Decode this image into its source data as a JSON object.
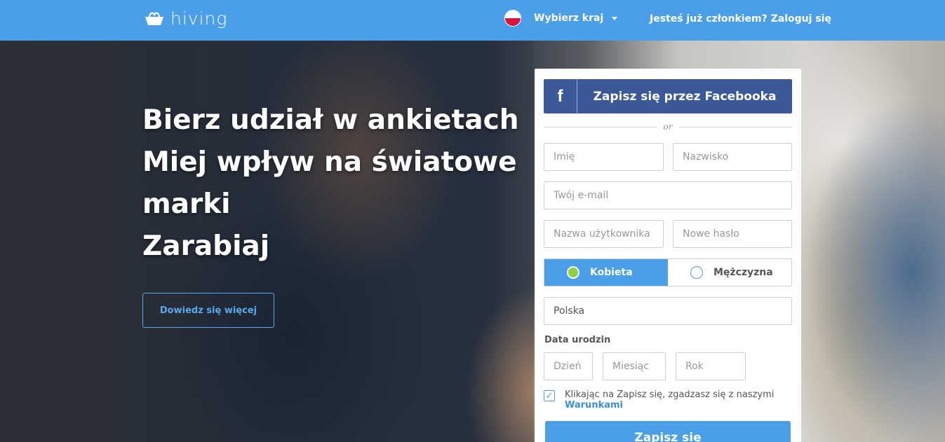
{
  "header": {
    "logo_text": "hiving",
    "country_label": "Wybierz kraj",
    "flag_icon": "poland-flag-icon",
    "login_link": "Jesteś już członkiem? Zaloguj się"
  },
  "hero": {
    "headline": [
      "Bierz udział w ankietach",
      "Miej wpływ na światowe",
      "marki",
      "Zarabiaj"
    ],
    "learn_more": "Dowiedz się więcej"
  },
  "signup": {
    "facebook_icon": "f",
    "facebook_label": "Zapisz się przez Facebooka",
    "or_text": "or",
    "first_name_placeholder": "Imię",
    "last_name_placeholder": "Nazwisko",
    "email_placeholder": "Twój e-mail",
    "username_placeholder": "Nazwa użytkownika",
    "password_placeholder": "Nowe hasło",
    "gender": {
      "female": "Kobieta",
      "male": "Mężczyzna",
      "selected": "Kobieta"
    },
    "country_value": "Polska",
    "dob_label": "Data urodzin",
    "day_placeholder": "Dzień",
    "month_placeholder": "Miesiąc",
    "year_placeholder": "Rok",
    "terms_text": "Klikając na Zapisz się, zgadzasz się z naszymi",
    "terms_link": "Warunkami",
    "terms_checked": true,
    "submit_label": "Zapisz się"
  },
  "colors": {
    "primary": "#4a9fe8",
    "facebook": "#3b5998",
    "selected_radio": "#8dd23c"
  }
}
